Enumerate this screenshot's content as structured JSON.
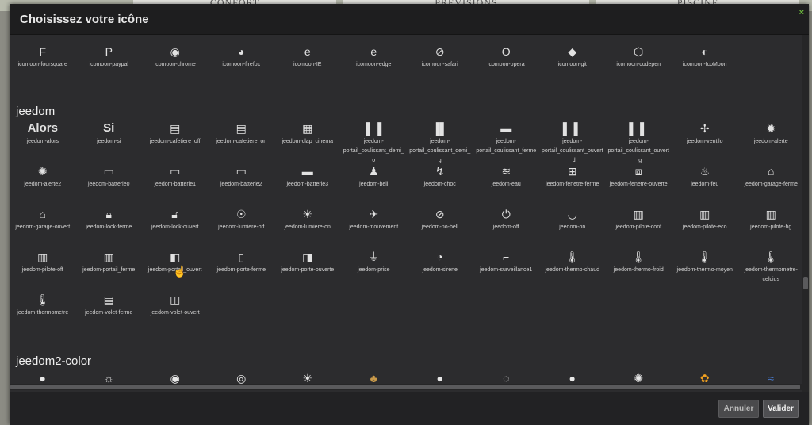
{
  "background": {
    "tabs": [
      "CONFORT",
      "PRÉVISIONS",
      "PISCINE"
    ]
  },
  "dialog": {
    "title": "Choisissez votre icône",
    "close_label": "×",
    "footer": {
      "cancel_label": "Annuler",
      "ok_label": "Valider"
    }
  },
  "sections": {
    "icomoon": {
      "items": [
        {
          "icon": "foursquare-icon",
          "glyph": "F",
          "label": "icomoon-foursquare"
        },
        {
          "icon": "paypal-icon",
          "glyph": "P",
          "label": "icomoon-paypal"
        },
        {
          "icon": "chrome-icon",
          "glyph": "◉",
          "label": "icomoon-chrome"
        },
        {
          "icon": "firefox-icon",
          "glyph": "◕",
          "label": "icomoon-firefox"
        },
        {
          "icon": "ie-icon",
          "glyph": "e",
          "label": "icomoon-IE"
        },
        {
          "icon": "edge-icon",
          "glyph": "e",
          "label": "icomoon-edge"
        },
        {
          "icon": "safari-icon",
          "glyph": "⊘",
          "label": "icomoon-safari"
        },
        {
          "icon": "opera-icon",
          "glyph": "O",
          "label": "icomoon-opera"
        },
        {
          "icon": "git-icon",
          "glyph": "◆",
          "label": "icomoon-git"
        },
        {
          "icon": "codepen-icon",
          "glyph": "⬡",
          "label": "icomoon-codepen"
        },
        {
          "icon": "icomoon-icon",
          "glyph": "◐",
          "label": "icomoon-IcoMoon"
        }
      ]
    },
    "jeedom": {
      "title": "jeedom",
      "items": [
        {
          "icon": "alors-icon",
          "glyph": "Alors",
          "text": true,
          "label": "jeedom-alors"
        },
        {
          "icon": "si-icon",
          "glyph": "Si",
          "text": true,
          "label": "jeedom-si"
        },
        {
          "icon": "cafetiere-off-icon",
          "glyph": "▤",
          "label": "jeedom-cafetiere_off"
        },
        {
          "icon": "cafetiere-on-icon",
          "glyph": "▤",
          "label": "jeedom-cafetiere_on"
        },
        {
          "icon": "clap-cinema-icon",
          "glyph": "▦",
          "label": "jeedom-clap_cinema"
        },
        {
          "icon": "portail-coulissant-demi-o-icon",
          "glyph": "▌▐",
          "label": "jeedom-portail_coulissant_demi_o"
        },
        {
          "icon": "portail-coulissant-demi-g-icon",
          "glyph": "▐▌",
          "label": "jeedom-portail_coulissant_demi_g"
        },
        {
          "icon": "portail-coulissant-ferme-icon",
          "glyph": "▬",
          "label": "jeedom-portail_coulissant_ferme"
        },
        {
          "icon": "portail-coulissant-ouvert-d-icon",
          "glyph": "▌ ▌",
          "label": "jeedom-portail_coulissant_ouvert_d"
        },
        {
          "icon": "portail-coulissant-ouvert-g-icon",
          "glyph": "▌ ▌",
          "label": "jeedom-portail_coulissant_ouvert_g"
        },
        {
          "icon": "ventilo-icon",
          "glyph": "✢",
          "label": "jeedom-ventilo"
        },
        {
          "icon": "alerte-icon",
          "glyph": "✹",
          "label": "jeedom-alerte"
        },
        {
          "icon": "alerte2-icon",
          "glyph": "✺",
          "label": "jeedom-alerte2"
        },
        {
          "icon": "batterie0-icon",
          "glyph": "▭",
          "label": "jeedom-batterie0"
        },
        {
          "icon": "batterie1-icon",
          "glyph": "▭",
          "label": "jeedom-batterie1"
        },
        {
          "icon": "batterie2-icon",
          "glyph": "▭",
          "label": "jeedom-batterie2"
        },
        {
          "icon": "batterie3-icon",
          "glyph": "▬",
          "label": "jeedom-batterie3"
        },
        {
          "icon": "bell-icon",
          "glyph": "♟",
          "label": "jeedom-bell"
        },
        {
          "icon": "choc-icon",
          "glyph": "↯",
          "label": "jeedom-choc"
        },
        {
          "icon": "eau-icon",
          "glyph": "≋",
          "label": "jeedom-eau"
        },
        {
          "icon": "fenetre-ferme-icon",
          "glyph": "⊞",
          "label": "jeedom-fenetre-ferme"
        },
        {
          "icon": "fenetre-ouverte-icon",
          "glyph": "⧈",
          "label": "jeedom-fenetre-ouverte"
        },
        {
          "icon": "feu-icon",
          "glyph": "♨",
          "label": "jeedom-feu"
        },
        {
          "icon": "garage-ferme-icon",
          "glyph": "⌂",
          "label": "jeedom-garage-ferme"
        },
        {
          "icon": "garage-ouvert-icon",
          "glyph": "⌂",
          "label": "jeedom-garage-ouvert"
        },
        {
          "icon": "lock-ferme-icon",
          "glyph": "🔒︎",
          "label": "jeedom-lock-ferme"
        },
        {
          "icon": "lock-ouvert-icon",
          "glyph": "🔓︎",
          "label": "jeedom-lock-ouvert"
        },
        {
          "icon": "lumiere-off-icon",
          "glyph": "☉",
          "label": "jeedom-lumiere-off"
        },
        {
          "icon": "lumiere-on-icon",
          "glyph": "☀",
          "label": "jeedom-lumiere-on"
        },
        {
          "icon": "mouvement-icon",
          "glyph": "✈",
          "label": "jeedom-mouvement"
        },
        {
          "icon": "no-bell-icon",
          "glyph": "⊘",
          "label": "jeedom-no-bell"
        },
        {
          "icon": "off-icon",
          "glyph": "⏻",
          "label": "jeedom-off"
        },
        {
          "icon": "on-icon",
          "glyph": "◡",
          "label": "jeedom-on"
        },
        {
          "icon": "pilote-conf-icon",
          "glyph": "▥",
          "label": "jeedom-pilote-conf"
        },
        {
          "icon": "pilote-eco-icon",
          "glyph": "▥",
          "label": "jeedom-pilote-eco"
        },
        {
          "icon": "pilote-hg-icon",
          "glyph": "▥",
          "label": "jeedom-pilote-hg"
        },
        {
          "icon": "pilote-off-icon",
          "glyph": "▥",
          "label": "jeedom-pilote-off"
        },
        {
          "icon": "portail-ferme-icon",
          "glyph": "▥",
          "label": "jeedom-portail_ferme"
        },
        {
          "icon": "portail-ouvert-icon",
          "glyph": "◧",
          "label": "jeedom-portail_ouvert"
        },
        {
          "icon": "porte-ferme-icon",
          "glyph": "▯",
          "label": "jeedom-porte-ferme"
        },
        {
          "icon": "porte-ouverte-icon",
          "glyph": "◨",
          "label": "jeedom-porte-ouverte"
        },
        {
          "icon": "prise-icon",
          "glyph": "⏚",
          "label": "jeedom-prise"
        },
        {
          "icon": "sirene-icon",
          "glyph": "◔",
          "label": "jeedom-sirene"
        },
        {
          "icon": "surveillance1-icon",
          "glyph": "⌐",
          "label": "jeedom-surveillance1"
        },
        {
          "icon": "thermo-chaud-icon",
          "glyph": "🌡︎",
          "label": "jeedom-thermo-chaud"
        },
        {
          "icon": "thermo-froid-icon",
          "glyph": "🌡︎",
          "label": "jeedom-thermo-froid"
        },
        {
          "icon": "thermo-moyen-icon",
          "glyph": "🌡︎",
          "label": "jeedom-thermo-moyen"
        },
        {
          "icon": "thermometre-celcius-icon",
          "glyph": "🌡︎",
          "label": "jeedom-thermometre-celcius"
        },
        {
          "icon": "thermometre-icon",
          "glyph": "🌡︎",
          "label": "jeedom-thermometre"
        },
        {
          "icon": "volet-ferme-icon",
          "glyph": "▤",
          "label": "jeedom-volet-ferme"
        },
        {
          "icon": "volet-ouvert-icon",
          "glyph": "◫",
          "label": "jeedom-volet-ouvert"
        }
      ]
    },
    "jeedom2color": {
      "title": "jeedom2-color",
      "items": [
        {
          "icon": "bulb-icon",
          "glyph": "●",
          "color": "#e8e8e8"
        },
        {
          "icon": "bulb-rays-icon",
          "glyph": "☼",
          "color": "#e8e8e8"
        },
        {
          "icon": "bulb-outline-icon",
          "glyph": "◉",
          "color": "#e8e8e8"
        },
        {
          "icon": "bulb-outline2-icon",
          "glyph": "◎",
          "color": "#e8e8e8"
        },
        {
          "icon": "bulb-sparkle-icon",
          "glyph": "☀",
          "color": "#e8e8e8"
        },
        {
          "icon": "lamp-icon",
          "glyph": "♣",
          "color": "#c99a4a"
        },
        {
          "icon": "bulb2-icon",
          "glyph": "●",
          "color": "#e8e8e8"
        },
        {
          "icon": "bulb3-icon",
          "glyph": "◌",
          "color": "#e8e8e8"
        },
        {
          "icon": "bulb4-icon",
          "glyph": "●",
          "color": "#e8e8e8"
        },
        {
          "icon": "sparkle-icon",
          "glyph": "✺",
          "color": "#e8e8e8"
        },
        {
          "icon": "flower-icon",
          "glyph": "✿",
          "color": "#f0a020"
        },
        {
          "icon": "wind-icon",
          "glyph": "≈",
          "color": "#4a7cd0"
        }
      ]
    }
  }
}
